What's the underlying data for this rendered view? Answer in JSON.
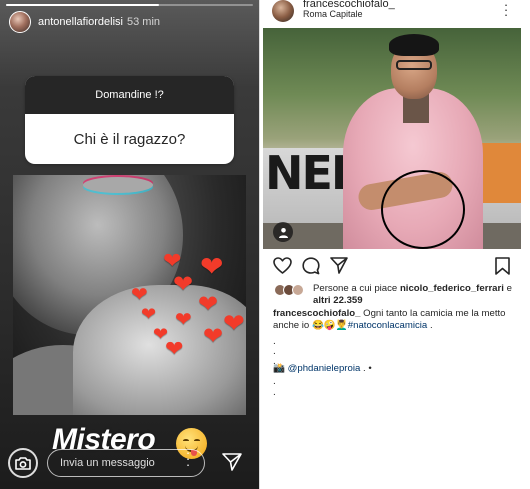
{
  "story": {
    "username": "antonellafiordelisi",
    "time": "53 min",
    "progress": 0.62,
    "question": {
      "header": "Domandine !?",
      "text": "Chi è il ragazzo?"
    },
    "sticker_text": "Mistero",
    "emoji": "squinting-face-with-tongue",
    "message_placeholder": "Invia un messaggio",
    "icons": [
      "camera-icon",
      "more-icon",
      "send-icon"
    ],
    "heart_color": "#f23b2a"
  },
  "post": {
    "username": "francescochiofalo_",
    "location": "Roma Capitale",
    "photo_text": "NEI",
    "likes_prefix": "Persone a cui piace",
    "likes_user": "nicolo_federico_ferrari",
    "likes_joiner": "e",
    "likes_count": "altri 22.359",
    "caption_user": "francescochiofalo_",
    "caption_text": "Ogni tanto la camicia me la metto anche io",
    "caption_emojis": "😂🤪💆‍♂️",
    "hashtag": "#natoconlacamicia",
    "caption_end": ".",
    "dots": [
      ".",
      ".",
      "."
    ],
    "credit_icon": "camera-with-flash-icon",
    "credit_user": "@phdanieleproia",
    "credit_trail": ". •",
    "dots_after": [
      ".",
      "."
    ],
    "icons": [
      "heart-icon",
      "comment-icon",
      "share-icon",
      "bookmark-icon"
    ]
  }
}
